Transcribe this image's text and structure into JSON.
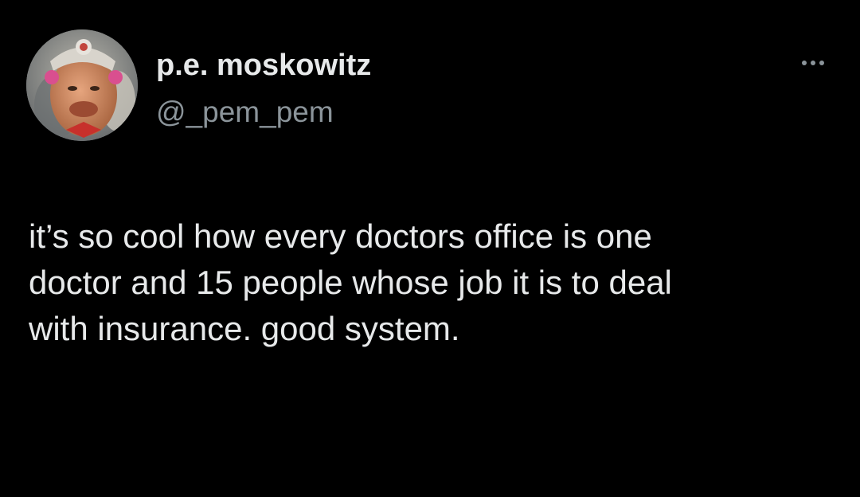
{
  "tweet": {
    "author": {
      "display_name": "p.e. moskowitz",
      "handle": "@_pem_pem",
      "avatar_icon": "profile-photo"
    },
    "more_icon": "more-options-icon",
    "text_lines": [
      "it’s so cool how every doctors office is one",
      "doctor and 15 people whose job it is to deal",
      "with insurance. good system."
    ]
  },
  "colors": {
    "background": "#000000",
    "primary_text": "#e7e9ea",
    "secondary_text": "#8b949a"
  }
}
